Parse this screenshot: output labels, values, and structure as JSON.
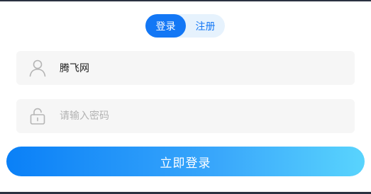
{
  "tabs": {
    "login_label": "登录",
    "register_label": "注册",
    "active": "login"
  },
  "form": {
    "username": {
      "value": "腾飞网",
      "icon": "user-icon"
    },
    "password": {
      "value": "",
      "placeholder": "请输入密码",
      "icon": "lock-icon"
    },
    "submit_label": "立即登录"
  },
  "colors": {
    "accent": "#1377f5",
    "gradient_start": "#0a80f7",
    "gradient_end": "#59d4fd",
    "field_background": "#f6f6f6",
    "placeholder_text": "#b3b3b3"
  }
}
